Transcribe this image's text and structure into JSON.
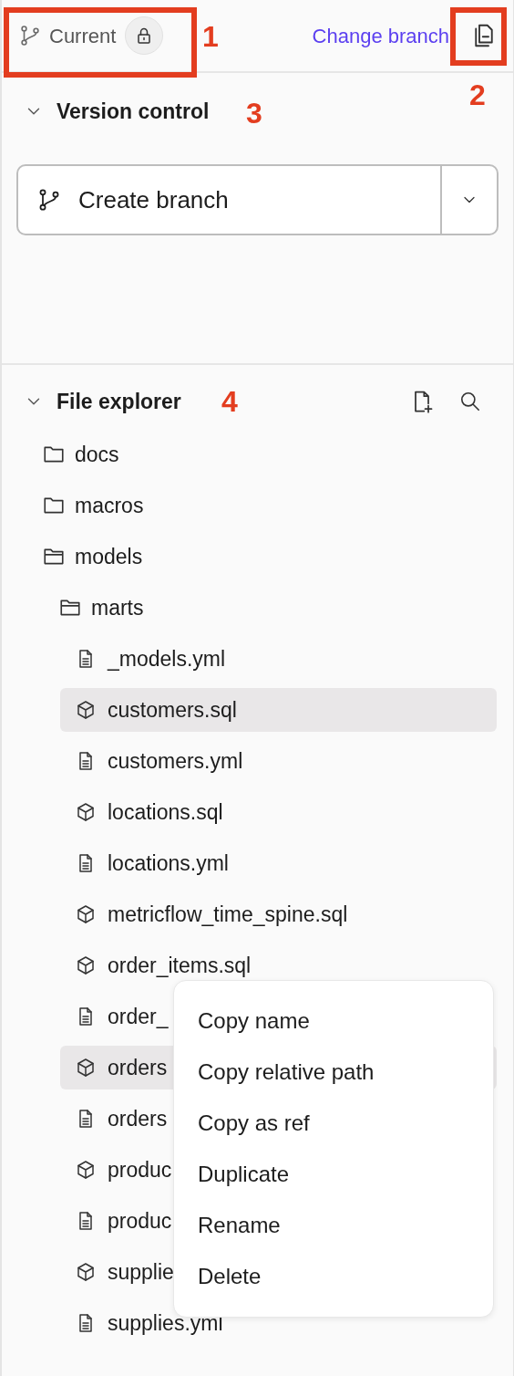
{
  "top_bar": {
    "branch_label": "Current",
    "locked": true,
    "link": "Change branch"
  },
  "version_control": {
    "title": "Version control",
    "expanded": true,
    "button": "Create branch"
  },
  "file_explorer": {
    "title": "File explorer",
    "expanded": true,
    "tree": [
      {
        "name": "docs",
        "kind": "folder",
        "expanded": false
      },
      {
        "name": "macros",
        "kind": "folder",
        "expanded": false
      },
      {
        "name": "models",
        "kind": "folder",
        "expanded": true,
        "children": [
          {
            "name": "marts",
            "kind": "folder",
            "expanded": true,
            "children": [
              {
                "name": "_models.yml",
                "kind": "file",
                "selected": false
              },
              {
                "name": "customers.sql",
                "kind": "model",
                "selected": true
              },
              {
                "name": "customers.yml",
                "kind": "file",
                "selected": false
              },
              {
                "name": "locations.sql",
                "kind": "model",
                "selected": false
              },
              {
                "name": "locations.yml",
                "kind": "file",
                "selected": false
              },
              {
                "name": "metricflow_time_spine.sql",
                "kind": "model",
                "selected": false
              },
              {
                "name": "order_items.sql",
                "kind": "model",
                "selected": false
              },
              {
                "name": "order_",
                "kind": "file",
                "selected": false
              },
              {
                "name": "orders",
                "kind": "model",
                "selected": true
              },
              {
                "name": "orders",
                "kind": "file",
                "selected": false
              },
              {
                "name": "produc",
                "kind": "model",
                "selected": false
              },
              {
                "name": "produc",
                "kind": "file",
                "selected": false
              },
              {
                "name": "supplie",
                "kind": "model",
                "selected": false
              },
              {
                "name": "supplies.yml",
                "kind": "file",
                "selected": false
              }
            ]
          }
        ]
      }
    ]
  },
  "context_menu": [
    "Copy name",
    "Copy relative path",
    "Copy as ref",
    "Duplicate",
    "Rename",
    "Delete"
  ],
  "annotations": [
    {
      "label": "1"
    },
    {
      "label": "2"
    },
    {
      "label": "3"
    },
    {
      "label": "4"
    }
  ]
}
